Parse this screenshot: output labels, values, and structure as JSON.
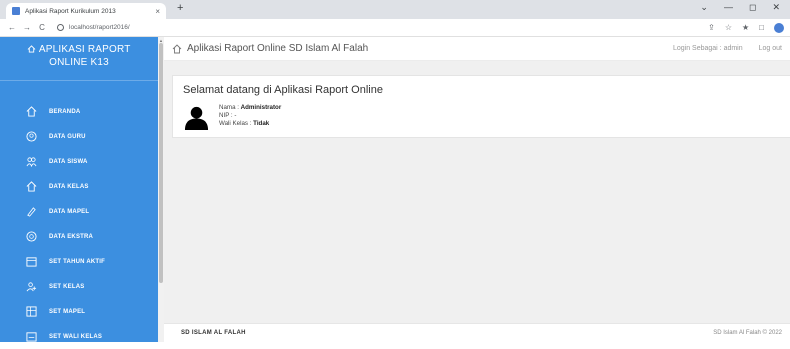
{
  "browser": {
    "tab_title": "Aplikasi Raport Kurikulum 2013",
    "tab_close": "×",
    "new_tab": "+",
    "url": "localhost/raport2016/",
    "back": "←",
    "forward": "→",
    "reload": "C",
    "win_controls": [
      "⌄",
      "—",
      "◻",
      "✕"
    ],
    "addr_icons": [
      "⇪",
      "☆",
      "★",
      "□"
    ]
  },
  "sidebar": {
    "title_line1": "APLIKASI RAPORT",
    "title_line2": "ONLINE K13",
    "items": [
      {
        "label": "BERANDA",
        "icon": "home-icon"
      },
      {
        "label": "DATA GURU",
        "icon": "person-icon"
      },
      {
        "label": "DATA SISWA",
        "icon": "group-icon"
      },
      {
        "label": "DATA KELAS",
        "icon": "class-icon"
      },
      {
        "label": "DATA MAPEL",
        "icon": "book-icon"
      },
      {
        "label": "DATA EKSTRA",
        "icon": "circle-icon"
      },
      {
        "label": "SET TAHUN AKTIF",
        "icon": "calendar-icon"
      },
      {
        "label": "SET KELAS",
        "icon": "user-add-icon"
      },
      {
        "label": "SET MAPEL",
        "icon": "grid-icon"
      },
      {
        "label": "SET WALI KELAS",
        "icon": "card-icon"
      }
    ]
  },
  "topbar": {
    "title": "Aplikasi Raport Online SD Islam Al Falah",
    "login_as": "Login Sebagai : admin",
    "logout": "Log out"
  },
  "welcome": {
    "heading": "Selamat datang di Aplikasi Raport Online",
    "name_label": "Nama : ",
    "name_value": "Administrator",
    "nip_label": "NIP : -",
    "wali_label": "Wali Kelas : ",
    "wali_value": "Tidak"
  },
  "footer": {
    "left": "SD ISLAM AL FALAH",
    "right": "SD Islam Al Falah © 2022"
  },
  "colors": {
    "sidebar_bg": "#3c8fe0",
    "content_bg": "#f0f0f0"
  }
}
